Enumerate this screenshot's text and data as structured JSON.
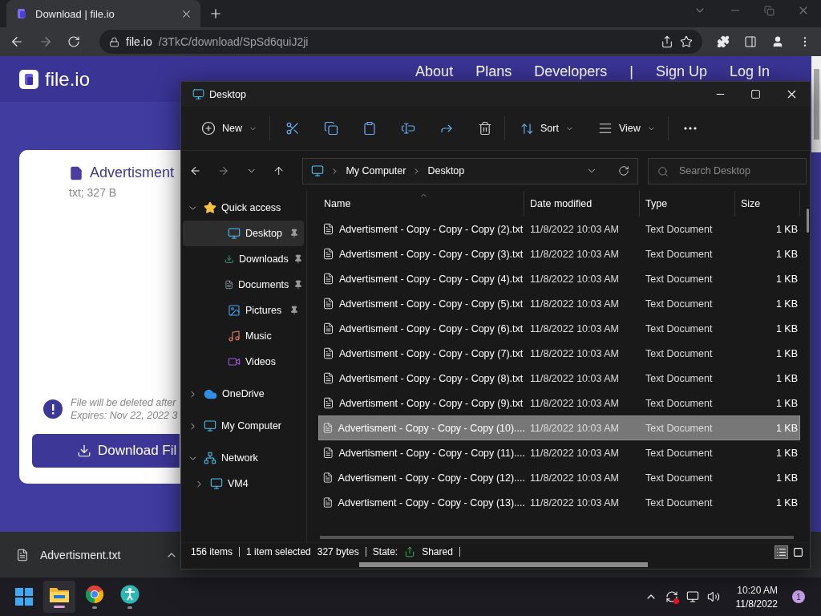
{
  "browser": {
    "tab": {
      "title": "Download | file.io",
      "selected": true
    },
    "address": {
      "host": "file.io",
      "path": "/3TkC/download/SpSd6quiJ2ji"
    }
  },
  "site": {
    "logo": "file.io",
    "nav": [
      "About",
      "Plans",
      "Developers",
      "|",
      "Sign Up",
      "Log In"
    ],
    "file": {
      "name": "Advertisment",
      "meta": "txt; 327 B"
    },
    "notice": [
      "File will be deleted after",
      "Expires: Nov 22, 2022 3"
    ],
    "download_button": "Download Fil"
  },
  "download_shelf": {
    "file": "Advertisment.txt"
  },
  "explorer": {
    "title": "Desktop",
    "toolbar": {
      "new": "New",
      "sort": "Sort",
      "view": "View"
    },
    "breadcrumb": [
      "My Computer",
      "Desktop"
    ],
    "search": {
      "placeholder": "Search Desktop"
    },
    "sidebar": {
      "items": [
        {
          "label": "Quick access",
          "kind": "star",
          "expanded": true,
          "selected": false,
          "children": [
            {
              "label": "Desktop",
              "kind": "desktop",
              "pinned": true,
              "selected": true
            },
            {
              "label": "Downloads",
              "kind": "download",
              "pinned": true,
              "selected": false
            },
            {
              "label": "Documents",
              "kind": "documents",
              "pinned": true,
              "selected": false
            },
            {
              "label": "Pictures",
              "kind": "pictures",
              "pinned": true,
              "selected": false
            },
            {
              "label": "Music",
              "kind": "music",
              "pinned": false,
              "selected": false
            },
            {
              "label": "Videos",
              "kind": "videos",
              "pinned": false,
              "selected": false
            }
          ]
        },
        {
          "label": "OneDrive",
          "kind": "cloud",
          "expanded": false,
          "selected": false
        },
        {
          "label": "My Computer",
          "kind": "computer",
          "expanded": false,
          "selected": false
        },
        {
          "label": "Network",
          "kind": "network",
          "expanded": true,
          "selected": false,
          "children": [
            {
              "label": "VM4",
              "kind": "computer",
              "expanded": false,
              "selected": false
            }
          ]
        }
      ]
    },
    "table": {
      "columns": [
        "Name",
        "Date modified",
        "Type",
        "Size"
      ],
      "rows": [
        {
          "name": "Advertisment - Copy - Copy - Copy (2).txt",
          "date": "11/8/2022 10:03 AM",
          "type": "Text Document",
          "size": "1 KB",
          "selected": false
        },
        {
          "name": "Advertisment - Copy - Copy - Copy (3).txt",
          "date": "11/8/2022 10:03 AM",
          "type": "Text Document",
          "size": "1 KB",
          "selected": false
        },
        {
          "name": "Advertisment - Copy - Copy - Copy (4).txt",
          "date": "11/8/2022 10:03 AM",
          "type": "Text Document",
          "size": "1 KB",
          "selected": false
        },
        {
          "name": "Advertisment - Copy - Copy - Copy (5).txt",
          "date": "11/8/2022 10:03 AM",
          "type": "Text Document",
          "size": "1 KB",
          "selected": false
        },
        {
          "name": "Advertisment - Copy - Copy - Copy (6).txt",
          "date": "11/8/2022 10:03 AM",
          "type": "Text Document",
          "size": "1 KB",
          "selected": false
        },
        {
          "name": "Advertisment - Copy - Copy - Copy (7).txt",
          "date": "11/8/2022 10:03 AM",
          "type": "Text Document",
          "size": "1 KB",
          "selected": false
        },
        {
          "name": "Advertisment - Copy - Copy - Copy (8).txt",
          "date": "11/8/2022 10:03 AM",
          "type": "Text Document",
          "size": "1 KB",
          "selected": false
        },
        {
          "name": "Advertisment - Copy - Copy - Copy (9).txt",
          "date": "11/8/2022 10:03 AM",
          "type": "Text Document",
          "size": "1 KB",
          "selected": false
        },
        {
          "name": "Advertisment - Copy - Copy - Copy (10)....",
          "date": "11/8/2022 10:03 AM",
          "type": "Text Document",
          "size": "1 KB",
          "selected": true
        },
        {
          "name": "Advertisment - Copy - Copy - Copy (11)....",
          "date": "11/8/2022 10:03 AM",
          "type": "Text Document",
          "size": "1 KB",
          "selected": false
        },
        {
          "name": "Advertisment - Copy - Copy - Copy (12)....",
          "date": "11/8/2022 10:03 AM",
          "type": "Text Document",
          "size": "1 KB",
          "selected": false
        },
        {
          "name": "Advertisment - Copy - Copy - Copy (13)....",
          "date": "11/8/2022 10:03 AM",
          "type": "Text Document",
          "size": "1 KB",
          "selected": false
        }
      ]
    },
    "status_bar": {
      "count": "156 items",
      "selection": "1 item selected",
      "size": "327 bytes",
      "state_label": "State:",
      "state": "Shared"
    }
  },
  "taskbar": {
    "apps": [
      {
        "kind": "explorer",
        "selected": true
      },
      {
        "kind": "chrome",
        "selected": false
      },
      {
        "kind": "accessibility",
        "selected": false
      }
    ],
    "time": "10:20 AM",
    "date": "11/8/2022",
    "badge": "1"
  }
}
